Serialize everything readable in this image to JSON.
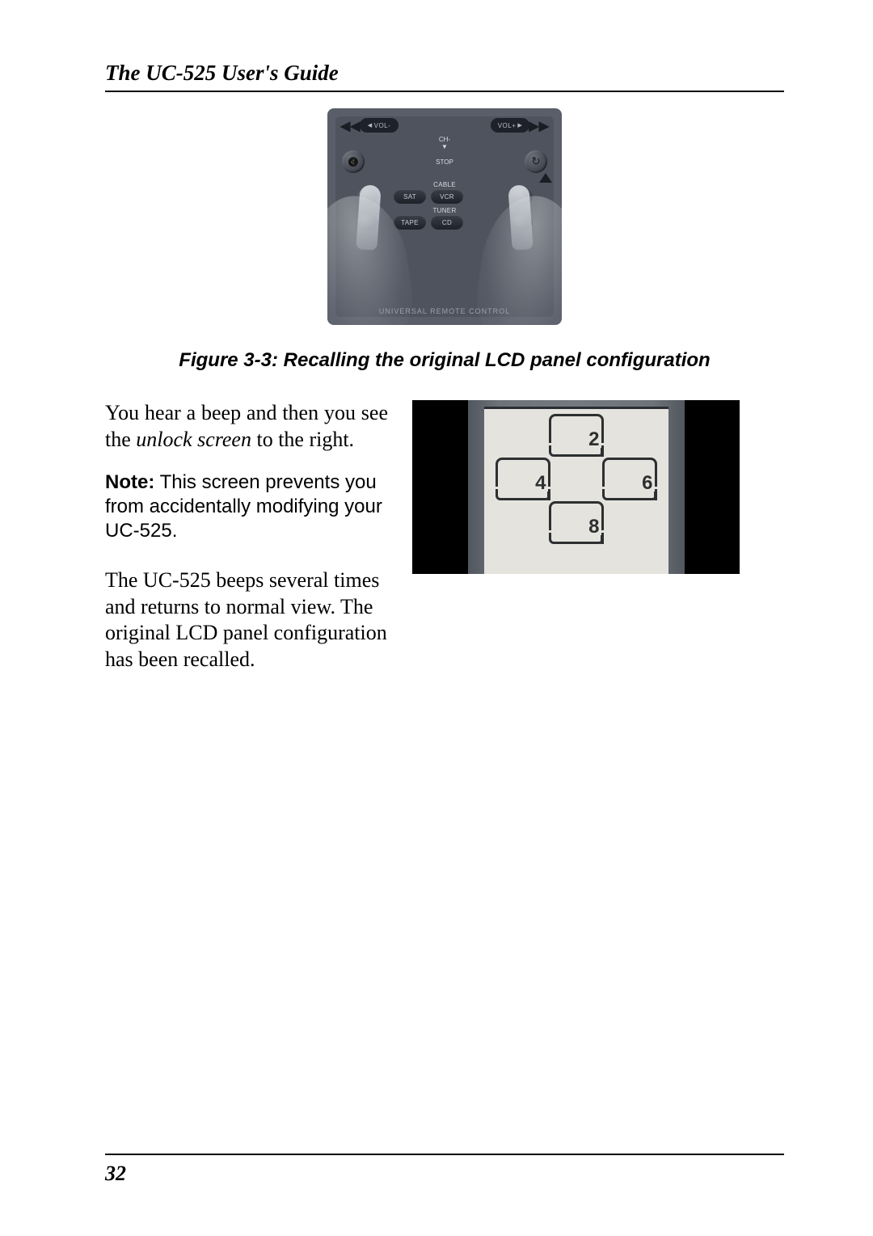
{
  "header": {
    "title": "The UC-525 User's Guide"
  },
  "remote": {
    "vol_minus": "VOL-",
    "vol_plus": "VOL+",
    "ch_label": "CH-",
    "stop_label": "STOP",
    "cable_label": "CABLE",
    "tuner_label": "TUNER",
    "sat": "SAT",
    "vcr": "VCR",
    "tape": "TAPE",
    "cd": "CD",
    "bottom_text": "UNIVERSAL REMOTE CONTROL"
  },
  "figure_caption": "Figure 3-3: Recalling the original LCD panel configuration",
  "body": {
    "p1_a": "You hear a beep and then you see the ",
    "p1_italic": "unlock screen",
    "p1_b": " to the right.",
    "note_label": "Note:",
    "note_text": " This screen prevents you from accidentally modifying your UC-525.",
    "p2": "The UC-525 beeps several times and returns to normal view.  The original LCD panel configuration has been recalled."
  },
  "lcd": {
    "n_top": "2",
    "n_left": "4",
    "n_right": "6",
    "n_bottom": "8"
  },
  "page_number": "32"
}
